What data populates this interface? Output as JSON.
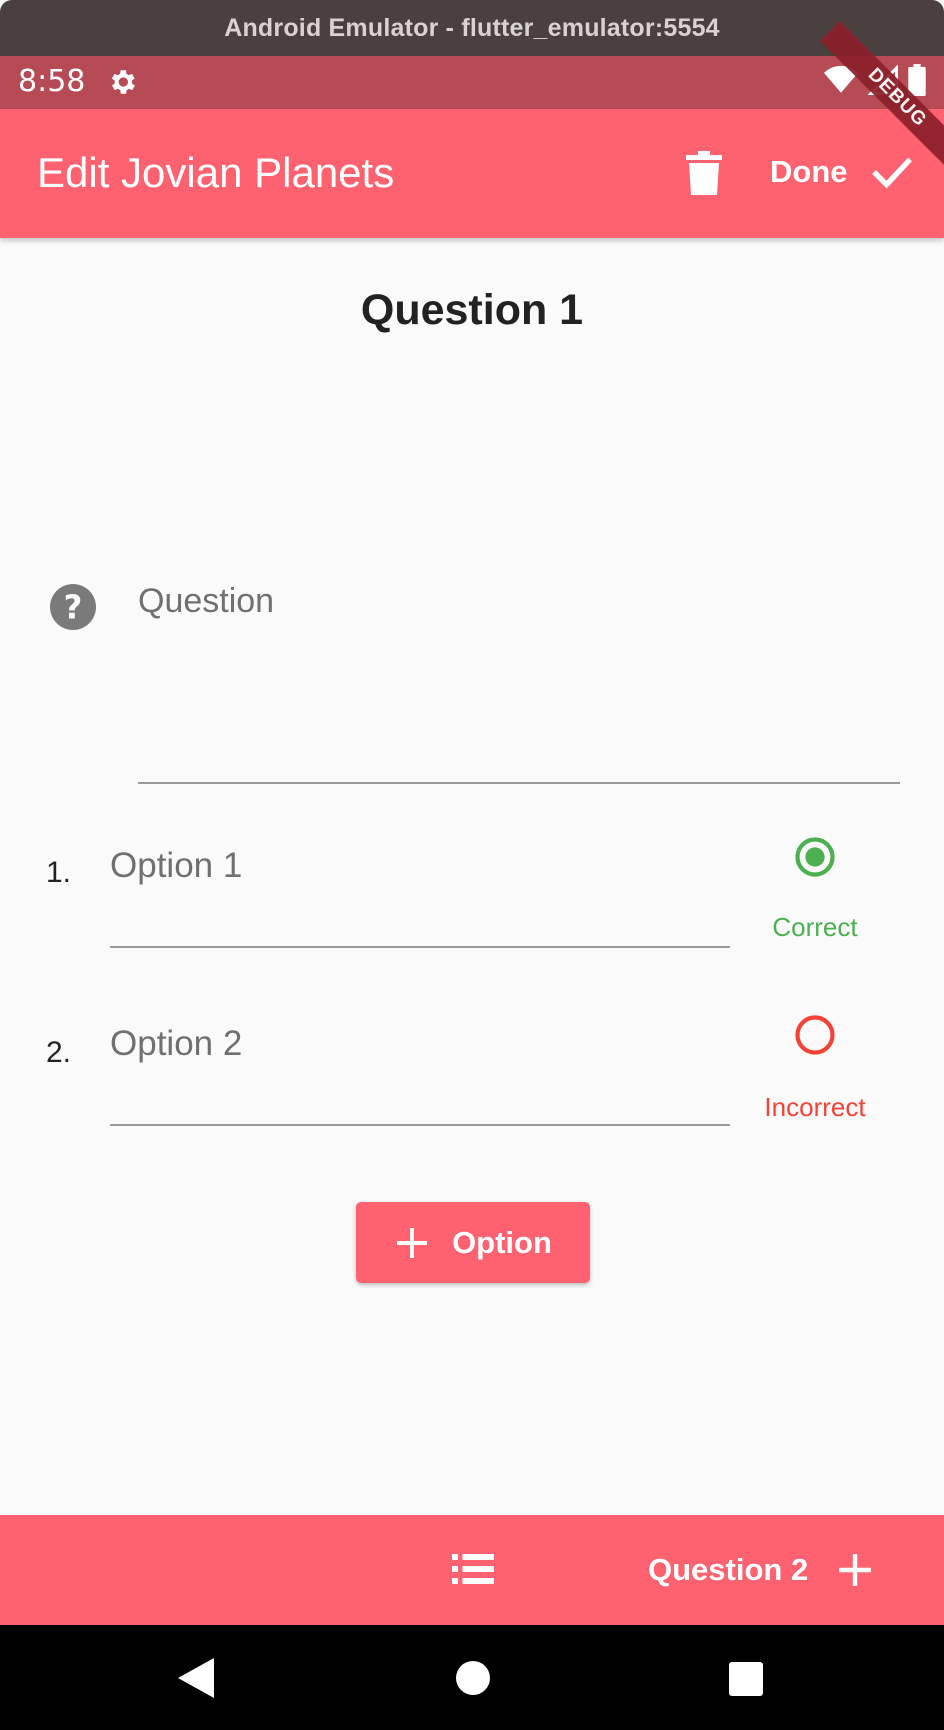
{
  "emulator": {
    "title": "Android Emulator - flutter_emulator:5554"
  },
  "status_bar": {
    "time": "8:58",
    "debug_banner": "DEBUG"
  },
  "app_bar": {
    "title": "Edit Jovian Planets",
    "done_label": "Done"
  },
  "main": {
    "question_heading": "Question 1",
    "question_placeholder": "Question",
    "options": [
      {
        "number": "1.",
        "placeholder": "Option 1",
        "status": "Correct",
        "selected": true
      },
      {
        "number": "2.",
        "placeholder": "Option 2",
        "status": "Incorrect",
        "selected": false
      }
    ],
    "add_option_label": "Option"
  },
  "bottom_bar": {
    "next_question_label": "Question 2"
  },
  "colors": {
    "primary": "#fe6270",
    "status_bar": "#b64a55",
    "correct": "#4caf50",
    "incorrect": "#f44336"
  }
}
